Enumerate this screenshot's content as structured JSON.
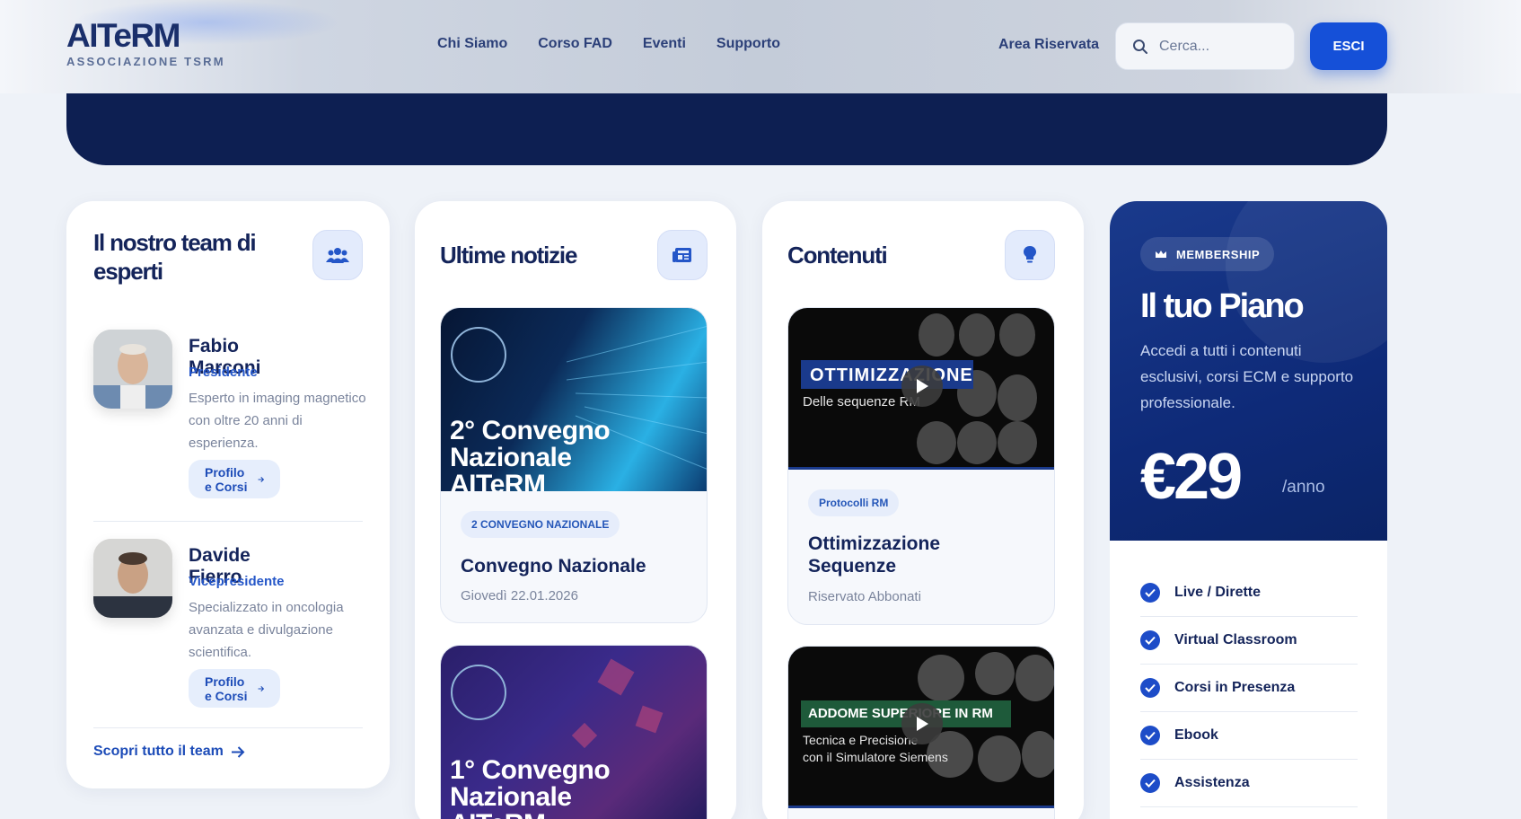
{
  "header": {
    "logo_title": "AITeRM",
    "logo_subtitle": "ASSOCIAZIONE TSRM",
    "nav": [
      "Chi Siamo",
      "Corso FAD",
      "Eventi",
      "Supporto"
    ],
    "area_label": "Area Riservata",
    "search_placeholder": "Cerca...",
    "logout_label": "ESCI"
  },
  "team": {
    "title": "Il nostro team di esperti",
    "members": [
      {
        "name": "Fabio Marconi",
        "role": "Presidente",
        "desc": "Esperto in imaging magnetico con oltre 20 anni di esperienza.",
        "button": "Profilo e Corsi"
      },
      {
        "name": "Davide Fierro",
        "role": "Vicepresidente",
        "desc": "Specializzato in oncologia avanzata e divulgazione scientifica.",
        "button": "Profilo e Corsi"
      }
    ],
    "link": "Scopri tutto il team"
  },
  "news": {
    "title": "Ultime notizie",
    "items": [
      {
        "image_line1": "2° Convegno",
        "image_line2": "Nazionale",
        "image_line3": "AITeRM",
        "tag": "2 CONVEGNO NAZIONALE",
        "title": "Convegno Nazionale",
        "meta": "Giovedì 22.01.2026"
      },
      {
        "image_line1": "1° Convegno",
        "image_line2": "Nazionale",
        "image_line3": "AITeRM"
      }
    ]
  },
  "content": {
    "title": "Contenuti",
    "items": [
      {
        "image_title": "OTTIMIZZAZIONE",
        "image_sub": "Delle sequenze RM",
        "tag": "Protocolli RM",
        "title": "Ottimizzazione Sequenze",
        "meta": "Riservato Abbonati"
      },
      {
        "image_title": "ADDOME SUPERIORE IN RM",
        "image_sub1": "Tecnica e Precisione",
        "image_sub2": "con il Simulatore Siemens"
      }
    ]
  },
  "plan": {
    "badge": "MEMBERSHIP",
    "title": "Il tuo Piano",
    "desc": "Accedi a tutti i contenuti esclusivi, corsi ECM e supporto professionale.",
    "price": "€29",
    "period": "/anno",
    "features": [
      "Live / Dirette",
      "Virtual Classroom",
      "Corsi in Presenza",
      "Ebook",
      "Assistenza"
    ]
  },
  "colors": {
    "accent": "#1550d8",
    "navy": "#0d1f52",
    "title": "#14245a"
  }
}
